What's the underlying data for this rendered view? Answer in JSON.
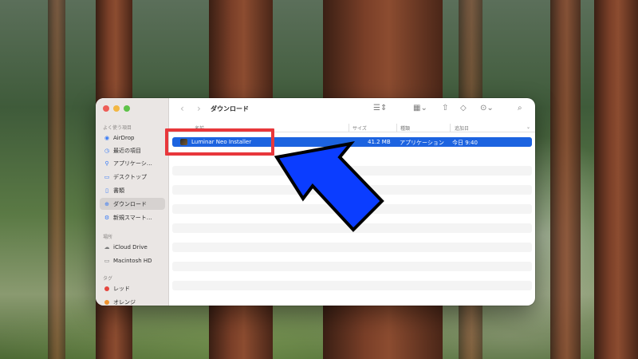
{
  "finder": {
    "title": "ダウンロード",
    "sidebar": {
      "favorites_label": "よく使う項目",
      "items": [
        {
          "label": "AirDrop",
          "icon": "airdrop-icon"
        },
        {
          "label": "最近の項目",
          "icon": "clock-icon"
        },
        {
          "label": "アプリケーシ…",
          "icon": "applications-icon"
        },
        {
          "label": "デスクトップ",
          "icon": "desktop-icon"
        },
        {
          "label": "書類",
          "icon": "document-icon"
        },
        {
          "label": "ダウンロード",
          "icon": "download-icon",
          "active": true
        },
        {
          "label": "新規スマート…",
          "icon": "smart-folder-icon"
        }
      ],
      "locations_label": "場所",
      "locations": [
        {
          "label": "iCloud Drive",
          "icon": "cloud-icon"
        },
        {
          "label": "Macintosh HD",
          "icon": "disk-icon"
        }
      ],
      "tags_label": "タグ",
      "tags": [
        {
          "label": "レッド",
          "color": "#e5453e"
        },
        {
          "label": "オレンジ",
          "color": "#f0922e"
        }
      ]
    },
    "columns": {
      "name": "名前",
      "size": "サイズ",
      "kind": "種類",
      "date_added": "追加日"
    },
    "files": [
      {
        "name": "Luminar Neo Installer",
        "size": "41.2 MB",
        "kind": "アプリケーション",
        "date_added": "今日 9:40",
        "selected": true
      }
    ],
    "toolbar_icons": [
      "chevron-left-icon",
      "chevron-right-icon",
      "list-view-icon",
      "group-icon",
      "share-icon",
      "tag-icon",
      "more-icon",
      "search-icon"
    ]
  },
  "colors": {
    "selection": "#1c63e0",
    "highlight": "#e8373b",
    "arrow": "#0b3dff"
  }
}
